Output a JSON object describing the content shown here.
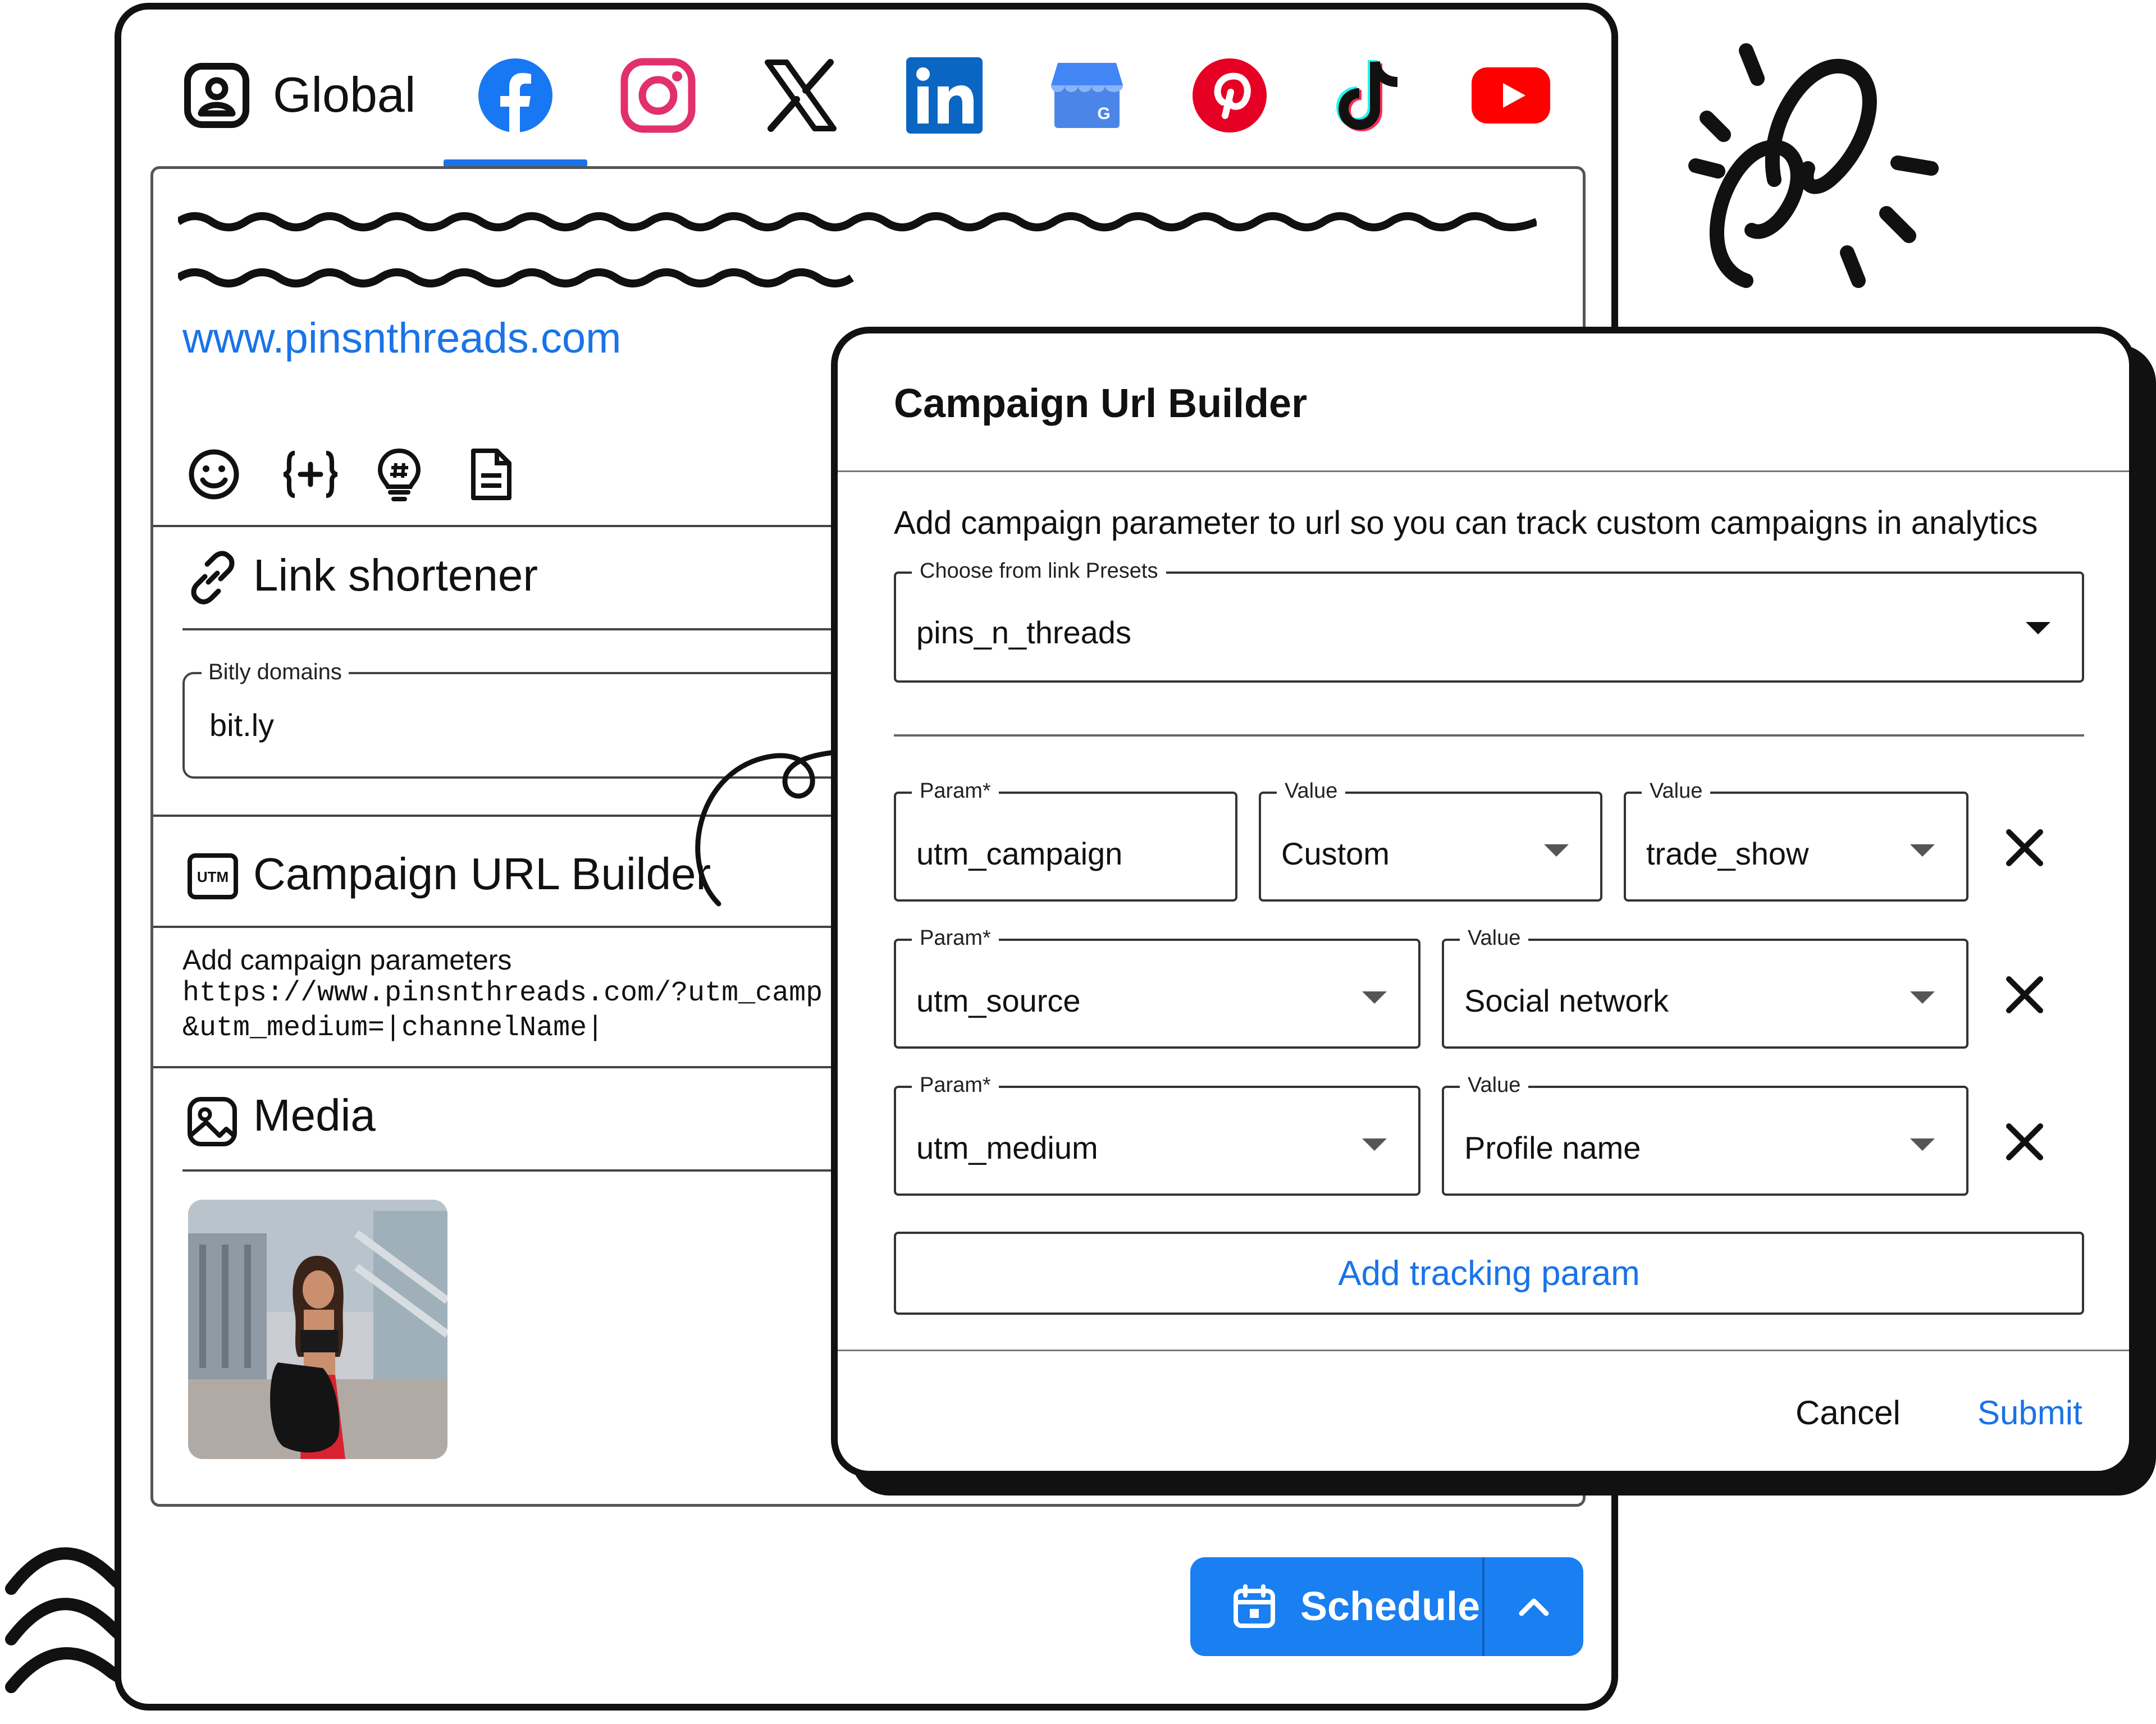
{
  "tabs": {
    "global_label": "Global",
    "networks": [
      "facebook-icon",
      "instagram-icon",
      "x-icon",
      "linkedin-icon",
      "google-business-icon",
      "pinterest-icon",
      "tiktok-icon",
      "youtube-icon"
    ]
  },
  "editor": {
    "link": "www.pinsnthreads.com",
    "toolbar_icons": [
      "emoji-icon",
      "variables-icon",
      "ideas-icon",
      "notes-icon"
    ]
  },
  "link_shortener": {
    "title": "Link shortener",
    "domains_label": "Bitly domains",
    "domain_value": "bit.ly"
  },
  "campaign_section": {
    "title": "Campaign URL Builder",
    "subtitle": "Add campaign parameters",
    "url_line1": "https://www.pinsnthreads.com/?utm_camp",
    "url_line2": "&utm_medium=|channelName|"
  },
  "media": {
    "title": "Media"
  },
  "modal": {
    "title": "Campaign Url Builder",
    "description": "Add campaign parameter to url so you can track custom campaigns in analytics",
    "preset_label": "Choose from link Presets",
    "preset_value": "pins_n_threads",
    "rows": [
      {
        "param_label": "Param*",
        "param": "utm_campaign",
        "value_label": "Value",
        "value": "Custom",
        "value2_label": "Value",
        "value2": "trade_show"
      },
      {
        "param_label": "Param*",
        "param": "utm_source",
        "value_label": "Value",
        "value": "Social network"
      },
      {
        "param_label": "Param*",
        "param": "utm_medium",
        "value_label": "Value",
        "value": "Profile name"
      }
    ],
    "add_button": "Add tracking param",
    "cancel": "Cancel",
    "submit": "Submit"
  },
  "schedule": {
    "label": "Schedule"
  },
  "colors": {
    "accent": "#1a73e8",
    "button": "#1a7ff0",
    "facebook": "#1877f2",
    "instagram": "#e1306c",
    "linkedin": "#0a66c2",
    "pinterest": "#e60023",
    "youtube": "#ff0000"
  }
}
